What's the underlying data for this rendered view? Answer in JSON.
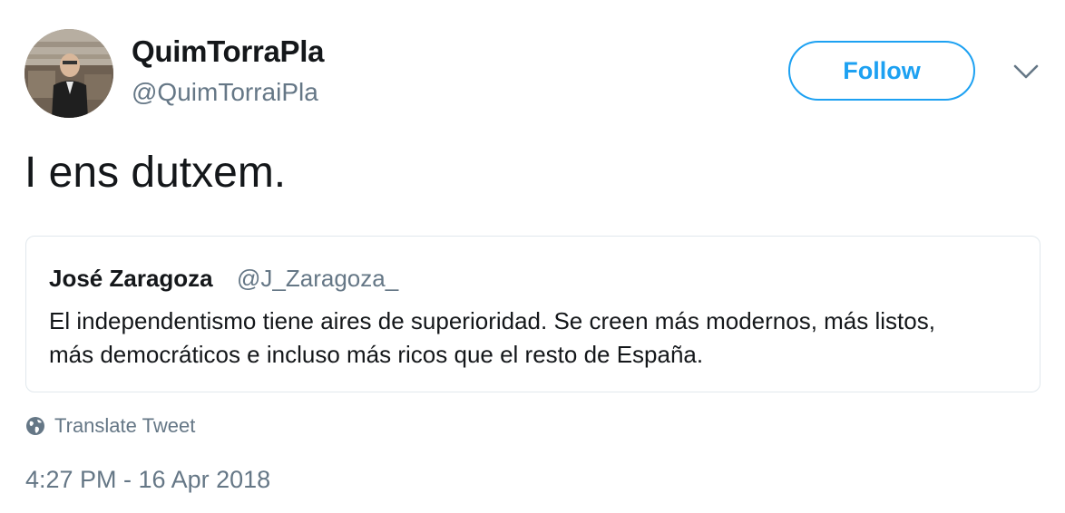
{
  "author": {
    "display_name": "QuimTorraPla",
    "handle": "@QuimTorraiPla"
  },
  "follow_button": {
    "label": "Follow"
  },
  "tweet": {
    "text": "I ens dutxem."
  },
  "quoted_tweet": {
    "display_name": "José Zaragoza",
    "handle": "@J_Zaragoza_",
    "text_line_1": "El independentismo tiene aires de superioridad. Se creen más modernos, más listos,",
    "text_line_2": "más democráticos e incluso más ricos que el resto de España."
  },
  "translate": {
    "label": "Translate Tweet"
  },
  "timestamp": "4:27 PM - 16 Apr 2018",
  "icons": {
    "avatar": "profile-photo",
    "caret": "chevron-down-icon",
    "translate": "globe-icon"
  },
  "colors": {
    "accent": "#1da1f2",
    "secondary_text": "#657786",
    "primary_text": "#14171a",
    "border": "#e1e8ed"
  }
}
